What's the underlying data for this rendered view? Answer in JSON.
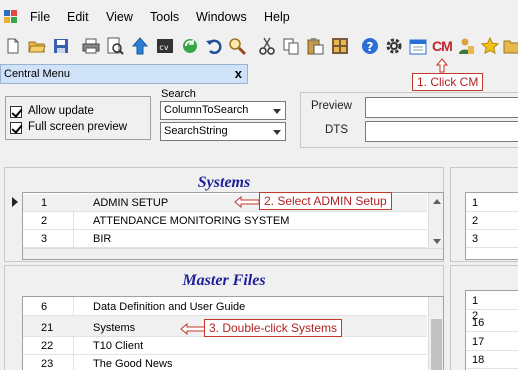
{
  "menubar": {
    "items": [
      "File",
      "Edit",
      "View",
      "Tools",
      "Windows",
      "Help"
    ]
  },
  "toolbar": {
    "icons": [
      "new-icon",
      "open-folder-icon",
      "save-icon",
      "print-icon",
      "print-preview-icon",
      "up-arrow-icon",
      "console-icon",
      "refresh-icon",
      "undo-icon",
      "search-tool-icon",
      "cut-icon",
      "copy-icon",
      "paste-icon",
      "grid-icon",
      "help-icon",
      "gear-icon",
      "calendar-icon",
      "cm-icon",
      "user-icon",
      "star-icon",
      "folder-icon"
    ],
    "cm_label": "CM"
  },
  "panel": {
    "title": "Central Menu",
    "close": "x"
  },
  "options": {
    "allow_update": "Allow update",
    "full_screen_preview": "Full screen preview"
  },
  "search": {
    "legend": "Search",
    "column": "ColumnToSearch",
    "string": "SearchString"
  },
  "preview": {
    "preview_label": "Preview",
    "dts_label": "DTS"
  },
  "systems": {
    "title": "Systems",
    "rows": [
      {
        "id": "1",
        "name": "ADMIN SETUP"
      },
      {
        "id": "2",
        "name": "ATTENDANCE MONITORING SYSTEM"
      },
      {
        "id": "3",
        "name": "BIR"
      }
    ],
    "right_rows": [
      "1",
      "2",
      "3"
    ]
  },
  "master_files": {
    "title": "Master Files",
    "rows": [
      {
        "id": "6",
        "name": "Data Definition and User Guide"
      },
      {
        "id": "21",
        "name": "Systems"
      },
      {
        "id": "22",
        "name": "T10 Client"
      },
      {
        "id": "23",
        "name": "The Good News"
      }
    ],
    "right_rows": [
      "1",
      "16",
      "17",
      "18"
    ],
    "right_overlap": "2"
  },
  "annotations": {
    "step1": "1. Click CM",
    "step2": "2. Select ADMIN Setup",
    "step3": "3. Double-click Systems",
    "color": "#c0392b"
  }
}
